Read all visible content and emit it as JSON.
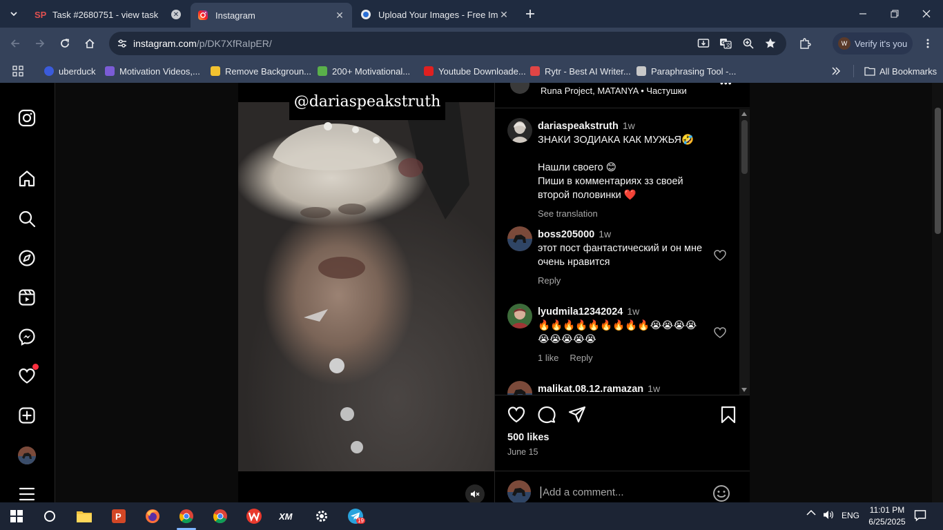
{
  "browser": {
    "tabs": [
      {
        "title": "Task #2680751 - view task",
        "active": false
      },
      {
        "title": "Instagram",
        "active": true
      },
      {
        "title": "Upload Your Images - Free Imag",
        "active": false
      }
    ],
    "url": {
      "host": "instagram.com",
      "path": "/p/DK7XfRaIpER/"
    },
    "verify_label": "Verify it's you",
    "verify_avatar_letter": "W",
    "bookmarks": [
      {
        "label": "uberduck",
        "color": "#3b5bdb"
      },
      {
        "label": "Motivation Videos,...",
        "color": "#7b5cd6"
      },
      {
        "label": "Remove Backgroun...",
        "color": "#f2c230"
      },
      {
        "label": "200+ Motivational...",
        "color": "#5ab04a"
      },
      {
        "label": "Youtube Downloade...",
        "color": "#e02020"
      },
      {
        "label": "Rytr - Best AI Writer...",
        "color": "#e04545"
      },
      {
        "label": "Paraphrasing Tool -...",
        "color": "#c8c8c8"
      }
    ],
    "all_bookmarks_label": "All Bookmarks"
  },
  "instagram": {
    "video": {
      "watermark": "@dariaspeakstruth"
    },
    "post_header": {
      "music": "Runa Project, MATANYA • Частушки",
      "more": "•••"
    },
    "comments": [
      {
        "user": "dariaspeakstruth",
        "time": "1w",
        "lines": [
          "ЗНАКИ ЗОДИАКА КАК МУЖЬЯ🤣",
          "",
          "Нашли своего 😊",
          "Пиши в комментариях зз своей второй половинки ❤️"
        ],
        "meta": [
          "See translation"
        ]
      },
      {
        "user": "boss205000",
        "time": "1w",
        "lines": [
          "этот пост фантастический и он мне очень нравится"
        ],
        "meta": [
          "Reply"
        ]
      },
      {
        "user": "lyudmila12342024",
        "time": "1w",
        "lines": [
          "🔥🔥🔥🔥🔥🔥🔥🔥🔥😭😭😭😭😭😭😭😭😭"
        ],
        "meta": [
          "1 like",
          "Reply"
        ]
      },
      {
        "user": "malikat.08.12.ramazan",
        "time": "1w",
        "lines": [],
        "meta": []
      }
    ],
    "likes": "500 likes",
    "date": "June 15",
    "comment_placeholder": "Add a comment..."
  },
  "taskbar": {
    "telegram_badge": "19",
    "language": "ENG",
    "time": "11:01 PM",
    "date": "6/25/2025"
  },
  "colors": {
    "instagram_bg": "#000000",
    "notification_red": "#ff3040",
    "chrome_tabstrip": "#1f2b40",
    "chrome_toolbar": "#35425a"
  }
}
